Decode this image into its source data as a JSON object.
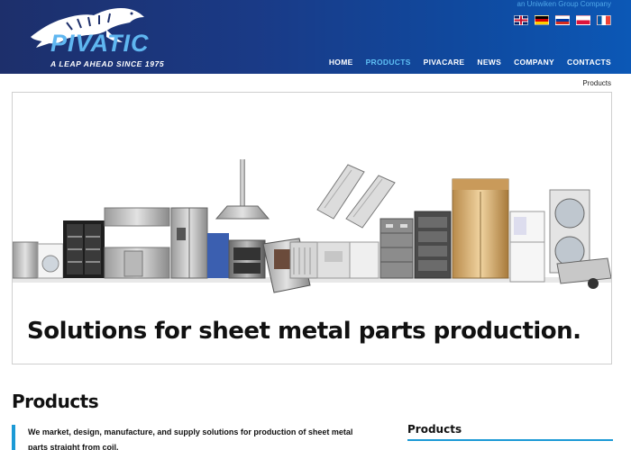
{
  "header": {
    "group_tag": "an Uniwiken Group Company",
    "logo_text": "PIVATIC",
    "logo_tagline": "A LEAP AHEAD SINCE 1975",
    "languages": [
      {
        "name": "English",
        "icon": "flag-uk-icon"
      },
      {
        "name": "German",
        "icon": "flag-de-icon"
      },
      {
        "name": "Russian",
        "icon": "flag-ru-icon"
      },
      {
        "name": "Polish",
        "icon": "flag-pl-icon"
      },
      {
        "name": "French",
        "icon": "flag-fr-icon"
      }
    ],
    "nav": [
      {
        "label": "HOME",
        "active": false
      },
      {
        "label": "PRODUCTS",
        "active": true
      },
      {
        "label": "PIVACARE",
        "active": false
      },
      {
        "label": "NEWS",
        "active": false
      },
      {
        "label": "COMPANY",
        "active": false
      },
      {
        "label": "CONTACTS",
        "active": false
      }
    ],
    "colors": {
      "accent": "#5fc0f5",
      "header_dark": "#1d2f6b",
      "header_light": "#0c58b6"
    }
  },
  "breadcrumb": "Products",
  "hero": {
    "caption": "Solutions for sheet metal parts production."
  },
  "main": {
    "title": "Products",
    "intro": "We market, design, manufacture, and supply solutions for production of sheet metal parts straight from coil.",
    "accent_color": "#1c9ad6"
  },
  "sidebar": {
    "title": "Products"
  }
}
